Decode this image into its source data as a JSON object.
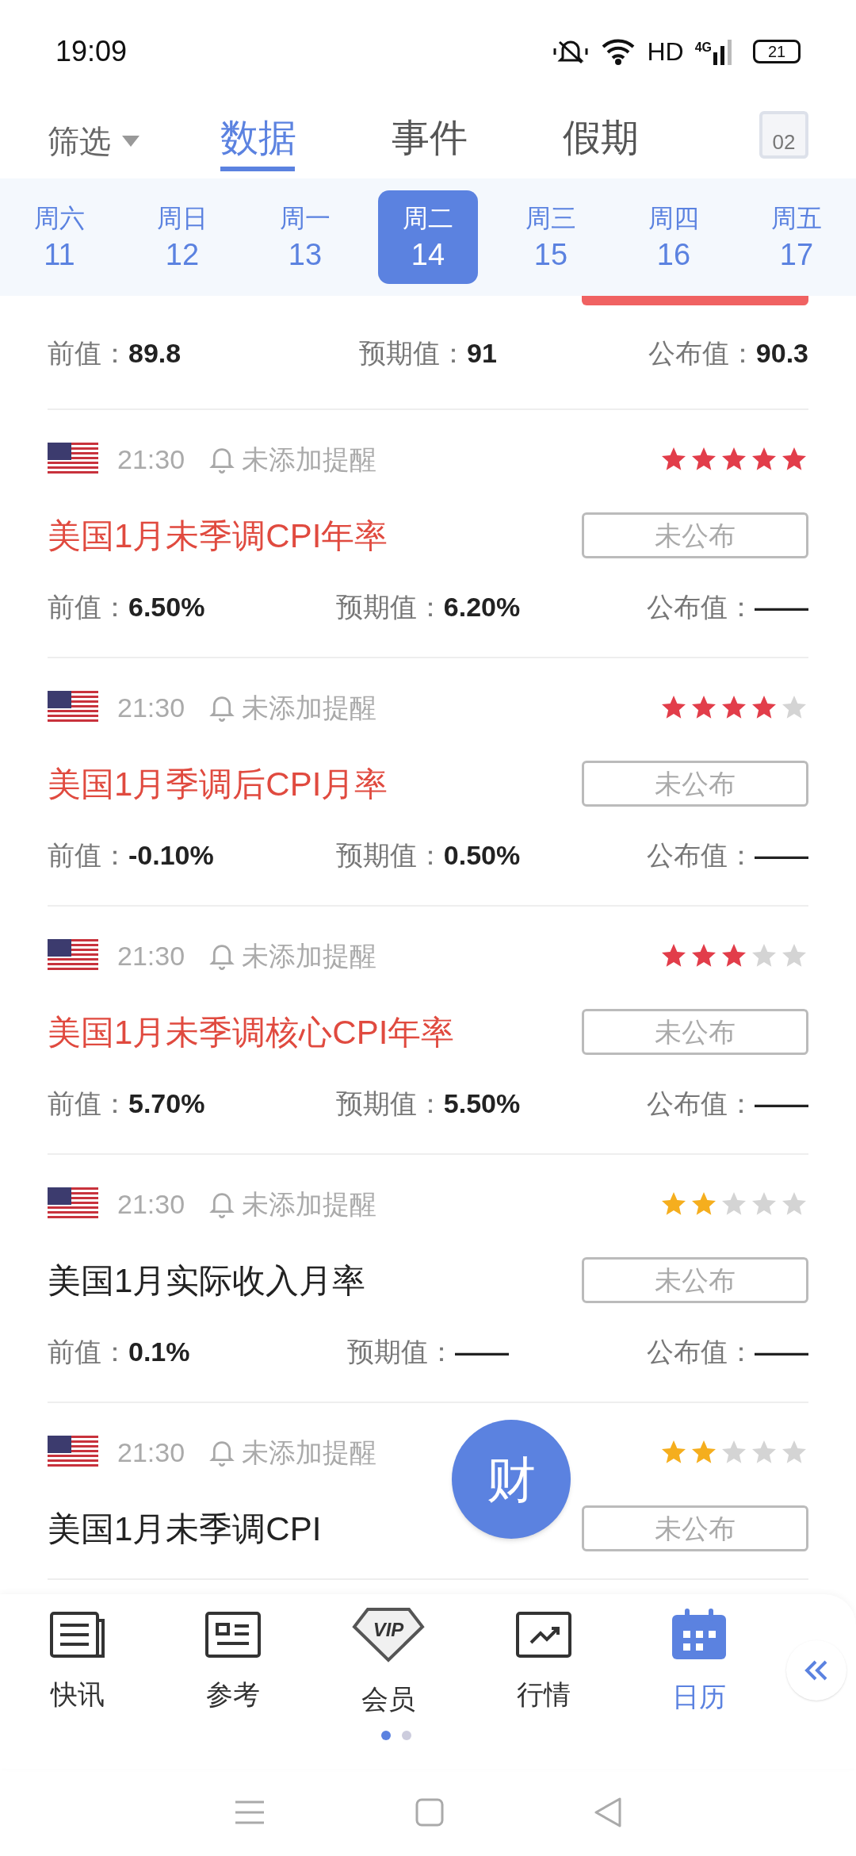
{
  "status_bar": {
    "time": "19:09",
    "network": "HD",
    "cell": "4G",
    "battery": "21"
  },
  "header": {
    "filter": "筛选",
    "calendar_day": "02",
    "tabs": [
      {
        "label": "数据",
        "selected": true
      },
      {
        "label": "事件",
        "selected": false
      },
      {
        "label": "假期",
        "selected": false
      }
    ]
  },
  "days": [
    {
      "weekday": "周六",
      "date": "11",
      "selected": false
    },
    {
      "weekday": "周日",
      "date": "12",
      "selected": false
    },
    {
      "weekday": "周一",
      "date": "13",
      "selected": false
    },
    {
      "weekday": "周二",
      "date": "14",
      "selected": true
    },
    {
      "weekday": "周三",
      "date": "15",
      "selected": false
    },
    {
      "weekday": "周四",
      "date": "16",
      "selected": false
    },
    {
      "weekday": "周五",
      "date": "17",
      "selected": false
    }
  ],
  "partial_item": {
    "previous_label": "前值：",
    "previous": "89.8",
    "forecast_label": "预期值：",
    "forecast": "91",
    "actual_label": "公布值：",
    "actual": "90.3"
  },
  "items": [
    {
      "time": "21:30",
      "reminder": "未添加提醒",
      "stars": 5,
      "title": "美国1月未季调CPI年率",
      "status": "未公布",
      "previous_label": "前值：",
      "previous": "6.50%",
      "forecast_label": "预期值：",
      "forecast": "6.20%",
      "actual_label": "公布值：",
      "actual": "——"
    },
    {
      "time": "21:30",
      "reminder": "未添加提醒",
      "stars": 4,
      "title": "美国1月季调后CPI月率",
      "status": "未公布",
      "previous_label": "前值：",
      "previous": "-0.10%",
      "forecast_label": "预期值：",
      "forecast": "0.50%",
      "actual_label": "公布值：",
      "actual": "——"
    },
    {
      "time": "21:30",
      "reminder": "未添加提醒",
      "stars": 3,
      "title": "美国1月未季调核心CPI年率",
      "status": "未公布",
      "previous_label": "前值：",
      "previous": "5.70%",
      "forecast_label": "预期值：",
      "forecast": "5.50%",
      "actual_label": "公布值：",
      "actual": "——"
    },
    {
      "time": "21:30",
      "reminder": "未添加提醒",
      "stars": 2,
      "title": "美国1月实际收入月率",
      "status": "未公布",
      "previous_label": "前值：",
      "previous": "0.1%",
      "forecast_label": "预期值：",
      "forecast": "——",
      "actual_label": "公布值：",
      "actual": "——"
    },
    {
      "time": "21:30",
      "reminder": "未添加提醒",
      "stars": 2,
      "title": "美国1月未季调CPI",
      "status": "未公布"
    }
  ],
  "fab": "财",
  "bottom_nav": {
    "vip_badge": "VIP",
    "items": [
      {
        "label": "快讯",
        "kind": "news",
        "selected": false
      },
      {
        "label": "参考",
        "kind": "reference",
        "selected": false
      },
      {
        "label": "会员",
        "kind": "vip",
        "selected": false
      },
      {
        "label": "行情",
        "kind": "market",
        "selected": false
      },
      {
        "label": "日历",
        "kind": "calendar",
        "selected": true
      }
    ],
    "pages": [
      {
        "selected": true
      },
      {
        "selected": false
      }
    ]
  }
}
